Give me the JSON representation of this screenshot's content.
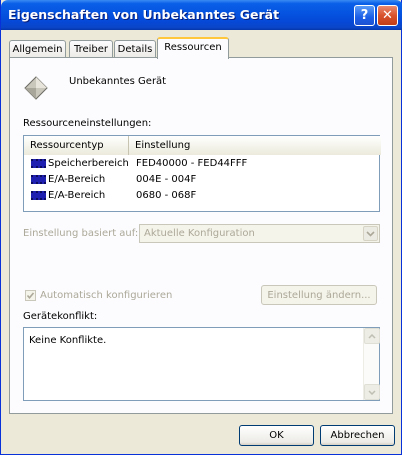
{
  "window": {
    "title": "Eigenschaften von Unbekanntes Gerät",
    "help_label": "?",
    "close_label": "✕"
  },
  "tabs": [
    {
      "label": "Allgemein",
      "active": false
    },
    {
      "label": "Treiber",
      "active": false
    },
    {
      "label": "Details",
      "active": false
    },
    {
      "label": "Ressourcen",
      "active": true
    }
  ],
  "device": {
    "name": "Unbekanntes Gerät",
    "icon": "unknown-device-icon"
  },
  "resources": {
    "label": "Ressourceneinstellungen:",
    "columns": [
      "Ressourcentyp",
      "Einstellung"
    ],
    "rows": [
      {
        "type": "Speicherbereich",
        "setting": "FED40000 - FED44FFF",
        "icon": "memory-chip-icon"
      },
      {
        "type": "E/A-Bereich",
        "setting": "004E - 004F",
        "icon": "memory-chip-icon"
      },
      {
        "type": "E/A-Bereich",
        "setting": "0680 - 068F",
        "icon": "memory-chip-icon"
      }
    ]
  },
  "config": {
    "label": "Einstellung basiert auf:",
    "selected": "Aktuelle Konfiguration"
  },
  "auto_config": {
    "label": "Automatisch konfigurieren",
    "checked": true
  },
  "change_button": "Einstellung ändern...",
  "conflict": {
    "label": "Gerätekonflikt:",
    "text": "Keine Konflikte."
  },
  "buttons": {
    "ok": "OK",
    "cancel": "Abbrechen"
  }
}
